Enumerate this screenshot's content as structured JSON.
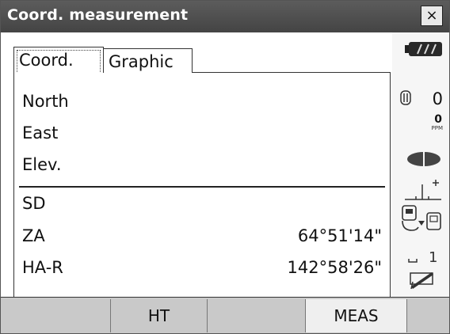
{
  "window": {
    "title": "Coord. measurement",
    "close_label": "×"
  },
  "tabs": [
    {
      "label": "Coord."
    },
    {
      "label": "Graphic"
    }
  ],
  "fields": [
    {
      "label": "North",
      "value": ""
    },
    {
      "label": "East",
      "value": ""
    },
    {
      "label": "Elev.",
      "value": ""
    },
    {
      "label": "SD",
      "value": ""
    },
    {
      "label": "ZA",
      "value": "64°51'14\""
    },
    {
      "label": "HA-R",
      "value": "142°58'26\""
    }
  ],
  "status": {
    "prism_constant": "0",
    "ppm_value": "0",
    "ppm_unit": "PPM",
    "battery_icon": "battery-icon",
    "target_icon": "target-icon",
    "tilt_icon": "tilt-icon",
    "bluetooth_icon": "instrument-icon",
    "input_mode_value": "1",
    "keyboard_icon": "edit-icon"
  },
  "softkeys": [
    "",
    "HT",
    "",
    "MEAS",
    ""
  ]
}
